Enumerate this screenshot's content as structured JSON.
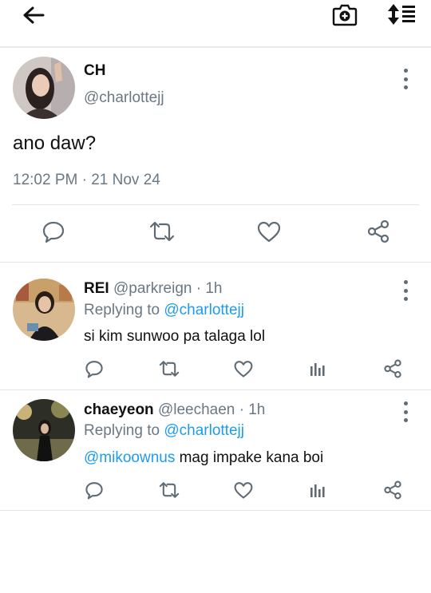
{
  "header": {
    "back_icon": "arrow-left-icon",
    "camera_icon": "camera-icon",
    "sort_icon": "sort-lines-icon"
  },
  "main_tweet": {
    "display_name": "CH",
    "handle": "@charlottejj",
    "text": "ano daw?",
    "timestamp": "12:02 PM · 21 Nov 24",
    "actions": [
      "comment-icon",
      "retweet-icon",
      "like-icon",
      "share-icon"
    ]
  },
  "replies": [
    {
      "display_name": "REI",
      "meta": "@parkreign · 1h",
      "replying_prefix": "Replying to",
      "replying_to": "@charlottejj",
      "mention": "",
      "text": "si kim sunwoo pa talaga lol"
    },
    {
      "display_name": "chaeyeon",
      "meta": "@leechaen · 1h",
      "replying_prefix": "Replying to",
      "replying_to": "@charlottejj",
      "mention": "@mikoownus",
      "text": " mag impake kana boi"
    }
  ],
  "colors": {
    "accent": "#1d9bf0",
    "muted": "#6a7884",
    "icon": "#5f6b75",
    "divider": "#e3e6e8"
  }
}
